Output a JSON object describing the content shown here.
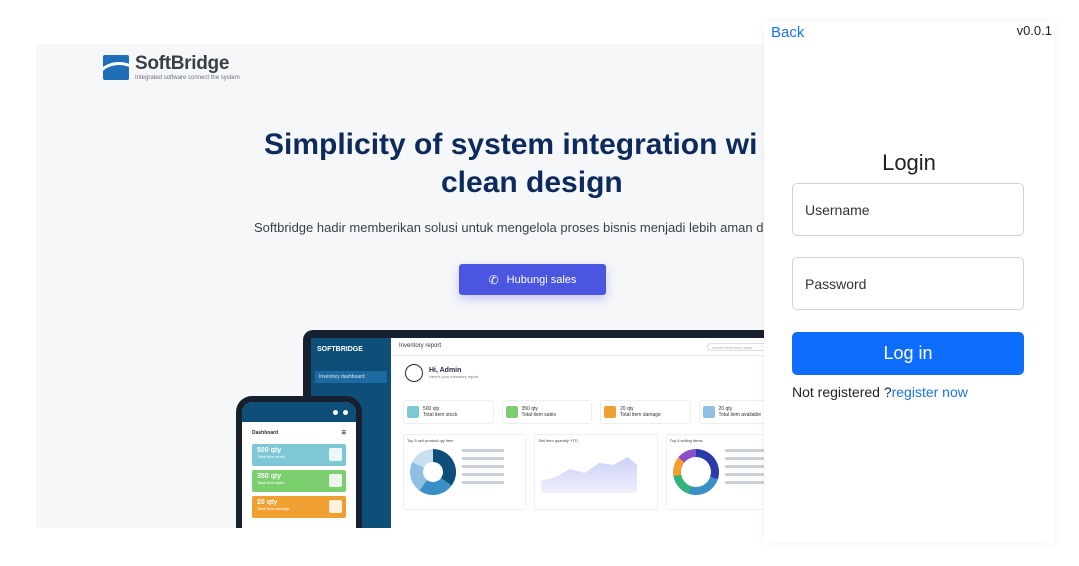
{
  "landing": {
    "brand": {
      "name": "SoftBridge",
      "tagline": "Integrated software connect the system"
    },
    "hero": {
      "title_line1": "Simplicity of system integration wi",
      "title_line2": "clean design",
      "subtitle": "Softbridge hadir memberikan solusi untuk mengelola proses bisnis menjadi lebih aman da"
    },
    "cta": {
      "label": "Hubungi sales",
      "icon": "phone-icon"
    },
    "mockup": {
      "laptop": {
        "logo": "SOFTBRIDGE",
        "nav_item": "Inventory dashboard",
        "page_title": "Inventory report",
        "search_placeholder": "search inventory name",
        "greeting": "Hi, Admin",
        "greeting_sub": "Here's your inventory report",
        "cards": [
          {
            "value": "500 qty",
            "label": "Total item stock",
            "color": "#7ec8d6"
          },
          {
            "value": "350 qty",
            "label": "Total item sales",
            "color": "#7ccf6f"
          },
          {
            "value": "20 qty",
            "label": "Total item damage",
            "color": "#f0a030"
          },
          {
            "value": "20 qty",
            "label": "Total item available",
            "color": "#8fc0e3"
          }
        ],
        "panels": [
          "Top 5 sell product qty item",
          "Sell item quantity YTD",
          "Top 5 selling items"
        ]
      },
      "phone": {
        "header": "Dashboard",
        "cards": [
          {
            "value": "500 qty",
            "label": "Total item stock",
            "color": "#7ec8d6"
          },
          {
            "value": "350 qty",
            "label": "Total item sales",
            "color": "#7ccf6f"
          },
          {
            "value": "20 qty",
            "label": "Total item damage",
            "color": "#f0a030"
          }
        ]
      }
    }
  },
  "login": {
    "back_label": "Back",
    "version": "v0.0.1",
    "title": "Login",
    "username_placeholder": "Username",
    "password_placeholder": "Password",
    "submit_label": "Log in",
    "register_prompt": "Not registered ?",
    "register_link": "register now"
  }
}
